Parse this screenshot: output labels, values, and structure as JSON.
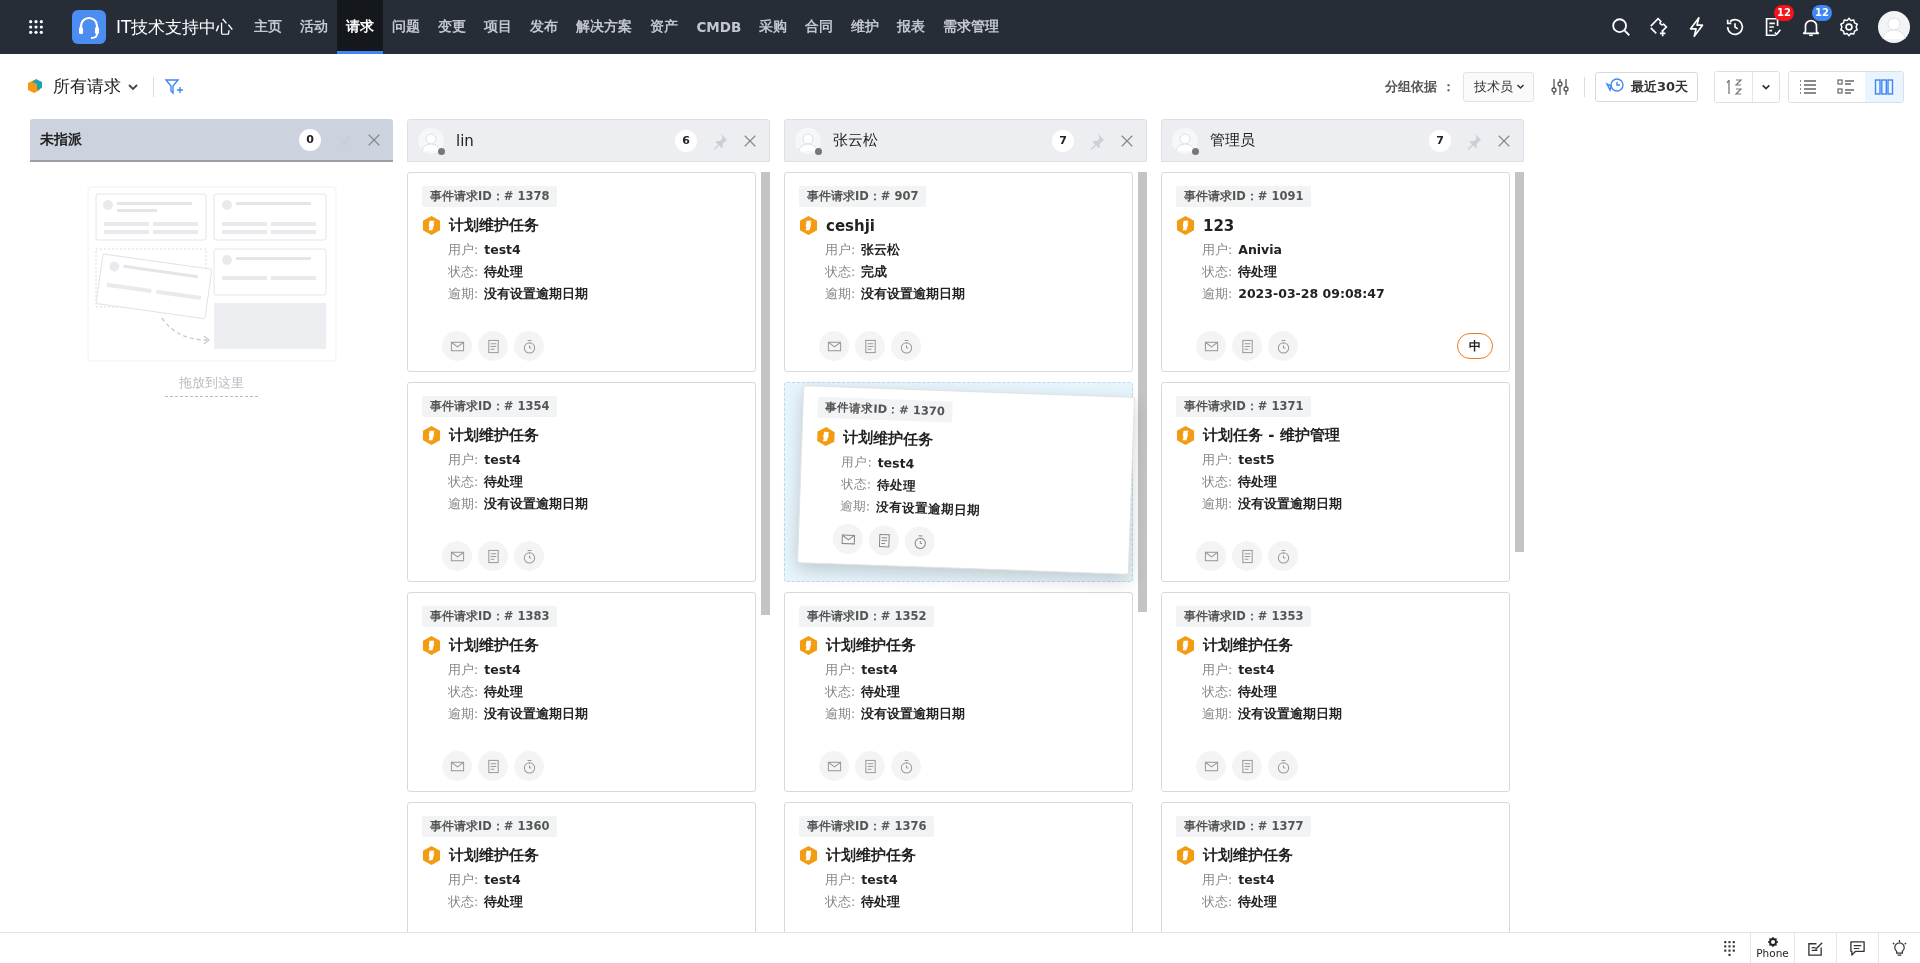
{
  "app": {
    "title": "IT技术支持中心"
  },
  "nav": [
    {
      "label": "主页",
      "selected": false
    },
    {
      "label": "活动",
      "selected": false
    },
    {
      "label": "请求",
      "selected": true
    },
    {
      "label": "问题",
      "selected": false
    },
    {
      "label": "变更",
      "selected": false
    },
    {
      "label": "项目",
      "selected": false
    },
    {
      "label": "发布",
      "selected": false
    },
    {
      "label": "解决方案",
      "selected": false
    },
    {
      "label": "资产",
      "selected": false
    },
    {
      "label": "CMDB",
      "selected": false
    },
    {
      "label": "采购",
      "selected": false
    },
    {
      "label": "合同",
      "selected": false
    },
    {
      "label": "维护",
      "selected": false
    },
    {
      "label": "报表",
      "selected": false
    },
    {
      "label": "需求管理",
      "selected": false
    }
  ],
  "header": {
    "tasks_badge": "12",
    "notifications_badge": "12"
  },
  "toolbar": {
    "view_title": "所有请求",
    "group_by_label": "分组依据 ：",
    "group_by_value": "技术员",
    "date_range": "最近30天",
    "views": [
      {
        "kind": "list",
        "selected": false
      },
      {
        "kind": "detail",
        "selected": false
      },
      {
        "kind": "board",
        "selected": true
      }
    ]
  },
  "columns": [
    {
      "kind": "unassigned",
      "title": "未指派",
      "count": "0",
      "drop_hint": "拖放到这里"
    },
    {
      "kind": "technician",
      "title": "lin",
      "count": "6",
      "cards": [
        {
          "kind": "ticket",
          "id": "事件请求ID：# 1378",
          "title": "计划维护任务",
          "fields": [
            {
              "label": "用户:",
              "value": "test4"
            },
            {
              "label": "状态:",
              "value": "待处理"
            },
            {
              "label": "逾期:",
              "value": "没有设置逾期日期"
            }
          ]
        },
        {
          "kind": "ticket",
          "id": "事件请求ID：# 1354",
          "title": "计划维护任务",
          "fields": [
            {
              "label": "用户:",
              "value": "test4"
            },
            {
              "label": "状态:",
              "value": "待处理"
            },
            {
              "label": "逾期:",
              "value": "没有设置逾期日期"
            }
          ]
        },
        {
          "kind": "ticket",
          "id": "事件请求ID：# 1383",
          "title": "计划维护任务",
          "fields": [
            {
              "label": "用户:",
              "value": "test4"
            },
            {
              "label": "状态:",
              "value": "待处理"
            },
            {
              "label": "逾期:",
              "value": "没有设置逾期日期"
            }
          ]
        },
        {
          "kind": "ticket",
          "id": "事件请求ID：# 1360",
          "title": "计划维护任务",
          "fields": [
            {
              "label": "用户:",
              "value": "test4"
            },
            {
              "label": "状态:",
              "value": "待处理"
            }
          ]
        }
      ]
    },
    {
      "kind": "technician",
      "title": "张云松",
      "count": "7",
      "cards": [
        {
          "kind": "ticket",
          "id": "事件请求ID：# 907",
          "title": "ceshji",
          "fields": [
            {
              "label": "用户:",
              "value": "张云松"
            },
            {
              "label": "状态:",
              "value": "完成"
            },
            {
              "label": "逾期:",
              "value": "没有设置逾期日期"
            }
          ]
        },
        {
          "kind": "drop-placeholder"
        },
        {
          "kind": "ticket",
          "id": "事件请求ID：# 1352",
          "title": "计划维护任务",
          "fields": [
            {
              "label": "用户:",
              "value": "test4"
            },
            {
              "label": "状态:",
              "value": "待处理"
            },
            {
              "label": "逾期:",
              "value": "没有设置逾期日期"
            }
          ]
        },
        {
          "kind": "ticket",
          "id": "事件请求ID：# 1376",
          "title": "计划维护任务",
          "fields": [
            {
              "label": "用户:",
              "value": "test4"
            },
            {
              "label": "状态:",
              "value": "待处理"
            }
          ]
        }
      ]
    },
    {
      "kind": "technician",
      "title": "管理员",
      "count": "7",
      "cards": [
        {
          "kind": "ticket",
          "id": "事件请求ID：# 1091",
          "title": "123",
          "fields": [
            {
              "label": "用户:",
              "value": "Anivia"
            },
            {
              "label": "状态:",
              "value": "待处理"
            },
            {
              "label": "逾期:",
              "value": "2023-03-28 09:08:47"
            }
          ],
          "priority": "中"
        },
        {
          "kind": "ticket",
          "id": "事件请求ID：# 1371",
          "title": "计划任务 - 维护管理",
          "fields": [
            {
              "label": "用户:",
              "value": "test5"
            },
            {
              "label": "状态:",
              "value": "待处理"
            },
            {
              "label": "逾期:",
              "value": "没有设置逾期日期"
            }
          ]
        },
        {
          "kind": "ticket",
          "id": "事件请求ID：# 1353",
          "title": "计划维护任务",
          "fields": [
            {
              "label": "用户:",
              "value": "test4"
            },
            {
              "label": "状态:",
              "value": "待处理"
            },
            {
              "label": "逾期:",
              "value": "没有设置逾期日期"
            }
          ]
        },
        {
          "kind": "ticket",
          "id": "事件请求ID：# 1377",
          "title": "计划维护任务",
          "fields": [
            {
              "label": "用户:",
              "value": "test4"
            },
            {
              "label": "状态:",
              "value": "待处理"
            }
          ]
        }
      ]
    }
  ],
  "dragged_card": {
    "id": "事件请求ID：# 1370",
    "title": "计划维护任务",
    "fields": [
      {
        "label": "用户:",
        "value": "test4"
      },
      {
        "label": "状态:",
        "value": "待处理"
      },
      {
        "label": "逾期:",
        "value": "没有设置逾期日期"
      }
    ]
  },
  "status_bar": {
    "phone_label": "Phone"
  }
}
